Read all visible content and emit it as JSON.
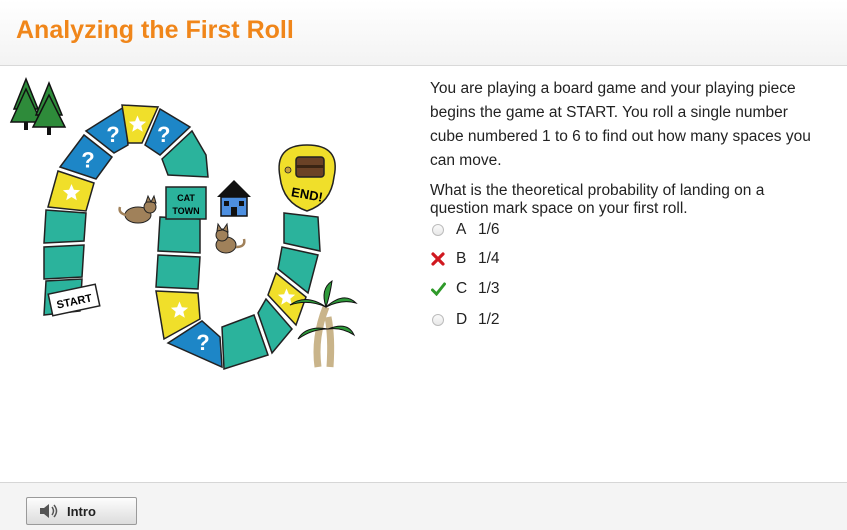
{
  "header": {
    "title": "Analyzing the First Roll"
  },
  "board": {
    "start_label": "START",
    "end_label": "END!",
    "town_label_line1": "CAT",
    "town_label_line2": "TOWN",
    "question_symbol": "?",
    "colors": {
      "teal": "#2bb39c",
      "yellow": "#f0df2a",
      "blue": "#1d86c7"
    }
  },
  "question": {
    "prompt": "You are playing a board game and your playing piece begins the game at START. You roll a single number cube numbered 1 to 6 to find out how many spaces you can move.",
    "sub": "What is the theoretical probability of landing on a question mark space on your first roll.",
    "choices": [
      {
        "letter": "A",
        "text": "1/6",
        "state": "unselected"
      },
      {
        "letter": "B",
        "text": "1/4",
        "state": "incorrect"
      },
      {
        "letter": "C",
        "text": "1/3",
        "state": "correct"
      },
      {
        "letter": "D",
        "text": "1/2",
        "state": "unselected"
      }
    ]
  },
  "footer": {
    "intro_label": "Intro",
    "icon": "speaker-icon"
  }
}
